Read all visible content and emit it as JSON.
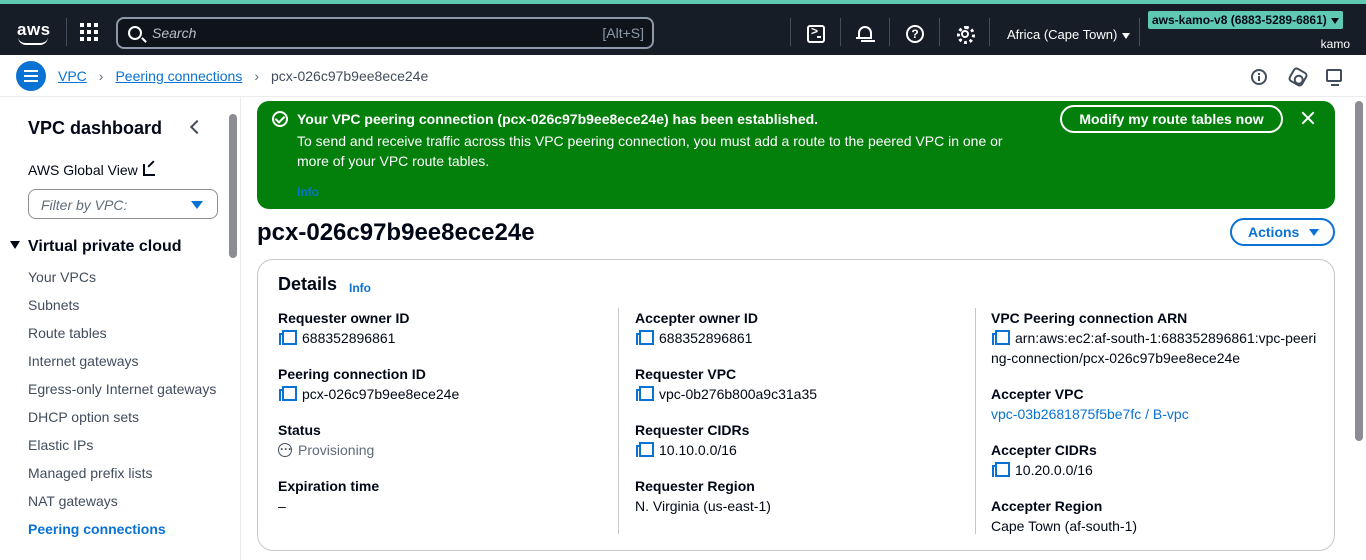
{
  "topbar": {
    "logo_text": "aws",
    "search_placeholder": "Search",
    "search_shortcut": "[Alt+S]",
    "region": "Africa (Cape Town)",
    "account": "aws-kamo-v8 (6883-5289-6861)",
    "username": "kamo"
  },
  "breadcrumb": {
    "items": [
      "VPC",
      "Peering connections"
    ],
    "current": "pcx-026c97b9ee8ece24e"
  },
  "sidenav": {
    "title": "VPC dashboard",
    "global_view": "AWS Global View",
    "filter_placeholder": "Filter by VPC:",
    "section": "Virtual private cloud",
    "items": [
      "Your VPCs",
      "Subnets",
      "Route tables",
      "Internet gateways",
      "Egress-only Internet gateways",
      "DHCP option sets",
      "Elastic IPs",
      "Managed prefix lists",
      "NAT gateways",
      "Peering connections"
    ],
    "active_index": 9
  },
  "flash": {
    "headline": "Your VPC peering connection (pcx-026c97b9ee8ece24e) has been established.",
    "body": "To send and receive traffic across this VPC peering connection, you must add a route to the peered VPC in one or more of your VPC route tables.",
    "info": "Info",
    "button": "Modify my route tables now",
    "color": "#037f0c"
  },
  "page": {
    "title": "pcx-026c97b9ee8ece24e",
    "actions": "Actions"
  },
  "details": {
    "heading": "Details",
    "info": "Info",
    "col1": {
      "requester_owner_label": "Requester owner ID",
      "requester_owner_value": "688352896861",
      "peering_id_label": "Peering connection ID",
      "peering_id_value": "pcx-026c97b9ee8ece24e",
      "status_label": "Status",
      "status_value": "Provisioning",
      "expiration_label": "Expiration time",
      "expiration_value": "–"
    },
    "col2": {
      "accepter_owner_label": "Accepter owner ID",
      "accepter_owner_value": "688352896861",
      "requester_vpc_label": "Requester VPC",
      "requester_vpc_value": "vpc-0b276b800a9c31a35",
      "requester_cidrs_label": "Requester CIDRs",
      "requester_cidrs_value": "10.10.0.0/16",
      "requester_region_label": "Requester Region",
      "requester_region_value": "N. Virginia (us-east-1)"
    },
    "col3": {
      "arn_label": "VPC Peering connection ARN",
      "arn_value": "arn:aws:ec2:af-south-1:688352896861:vpc-peering-connection/pcx-026c97b9ee8ece24e",
      "accepter_vpc_label": "Accepter VPC",
      "accepter_vpc_value": "vpc-03b2681875f5be7fc / B-vpc",
      "accepter_cidrs_label": "Accepter CIDRs",
      "accepter_cidrs_value": "10.20.0.0/16",
      "accepter_region_label": "Accepter Region",
      "accepter_region_value": "Cape Town (af-south-1)"
    }
  }
}
